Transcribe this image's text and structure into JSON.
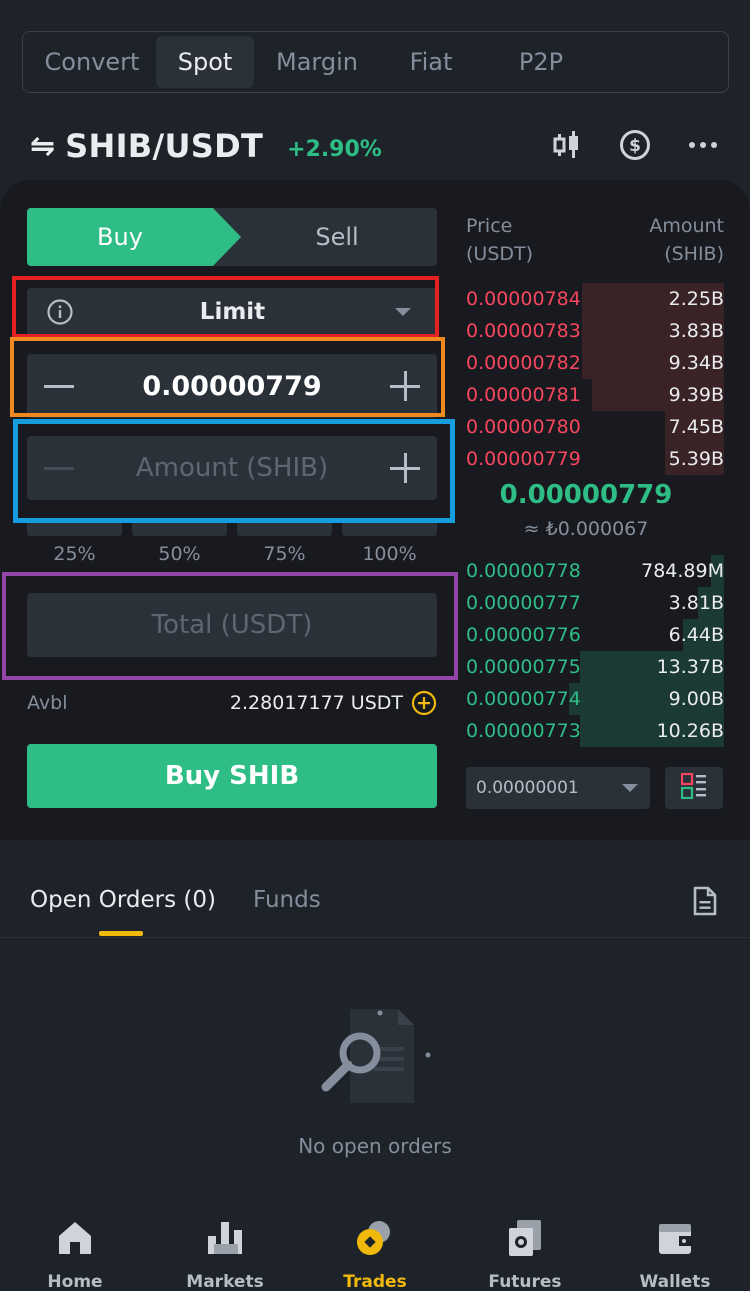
{
  "top_tabs": [
    {
      "label": "Convert",
      "active": false
    },
    {
      "label": "Spot",
      "active": true
    },
    {
      "label": "Margin",
      "active": false
    },
    {
      "label": "Fiat",
      "active": false
    },
    {
      "label": "P2P",
      "active": false
    }
  ],
  "pair": {
    "swap_glyph": "⇋",
    "name": "SHIB/USDT",
    "change": "+2.90%"
  },
  "header_icons": [
    "candlestick-chart-icon",
    "dollar-coin-icon",
    "more-icon"
  ],
  "trade_form": {
    "buy_label": "Buy",
    "sell_label": "Sell",
    "order_type": "Limit",
    "price_value": "0.00000779",
    "amount_placeholder": "Amount (SHIB)",
    "percents": [
      "25%",
      "50%",
      "75%",
      "100%"
    ],
    "total_placeholder": "Total (USDT)",
    "avbl_label": "Avbl",
    "avbl_value": "2.28017177 USDT",
    "submit_label": "Buy SHIB"
  },
  "order_book": {
    "price_header_1": "Price",
    "price_header_2": "(USDT)",
    "amount_header_1": "Amount",
    "amount_header_2": "(SHIB)",
    "asks": [
      {
        "price": "0.00000784",
        "amount": "2.25B",
        "depth": 0.55
      },
      {
        "price": "0.00000783",
        "amount": "3.83B",
        "depth": 0.55
      },
      {
        "price": "0.00000782",
        "amount": "9.34B",
        "depth": 0.55
      },
      {
        "price": "0.00000781",
        "amount": "9.39B",
        "depth": 0.51
      },
      {
        "price": "0.00000780",
        "amount": "7.45B",
        "depth": 0.23
      },
      {
        "price": "0.00000779",
        "amount": "5.39B",
        "depth": 0.23
      }
    ],
    "mid_price": "0.00000779",
    "mid_sub": "≈ ₺0.000067",
    "bids": [
      {
        "price": "0.00000778",
        "amount": "784.89M",
        "depth": 0.05
      },
      {
        "price": "0.00000777",
        "amount": "3.81B",
        "depth": 0.1
      },
      {
        "price": "0.00000776",
        "amount": "6.44B",
        "depth": 0.16
      },
      {
        "price": "0.00000775",
        "amount": "13.37B",
        "depth": 0.56
      },
      {
        "price": "0.00000774",
        "amount": "9.00B",
        "depth": 0.6
      },
      {
        "price": "0.00000773",
        "amount": "10.26B",
        "depth": 0.56
      }
    ],
    "tick_size": "0.00000001"
  },
  "orders": {
    "tab_open": "Open Orders (0)",
    "tab_funds": "Funds",
    "empty_text": "No open orders"
  },
  "bottom_nav": [
    {
      "label": "Home",
      "icon": "home-icon",
      "active": false
    },
    {
      "label": "Markets",
      "icon": "markets-icon",
      "active": false
    },
    {
      "label": "Trades",
      "icon": "trades-icon",
      "active": true
    },
    {
      "label": "Futures",
      "icon": "futures-icon",
      "active": false
    },
    {
      "label": "Wallets",
      "icon": "wallets-icon",
      "active": false
    }
  ],
  "colors": {
    "background": "#1e2329",
    "panel": "#181a20",
    "buy_green": "#2ebd85",
    "sell_red": "#f6465d",
    "accent_yellow": "#f0b90b",
    "annotation_red": "#e52222",
    "annotation_orange": "#f08a1f",
    "annotation_blue": "#169dde",
    "annotation_purple": "#9345a8"
  }
}
